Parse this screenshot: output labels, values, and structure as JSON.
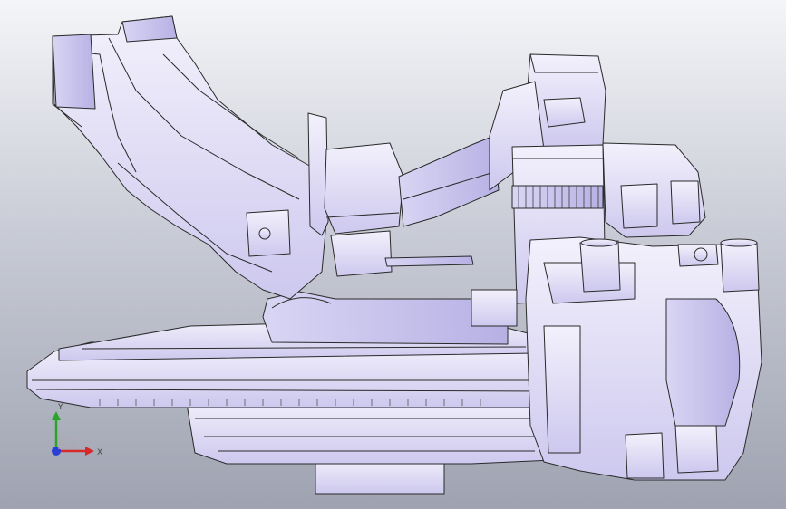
{
  "viewport": {
    "background_top": "#f4f5f8",
    "background_bottom": "#9fa3b1",
    "model_fill": "#e6e3f7",
    "model_shade": "#c9c4ec",
    "edge_color": "#2a2a2a"
  },
  "triad": {
    "x_label": "X",
    "y_label": "Y",
    "x_color": "#d62a2a",
    "y_color": "#2aa52a",
    "z_color": "#2a3fd6",
    "icon": "coordinate-triad-icon"
  }
}
